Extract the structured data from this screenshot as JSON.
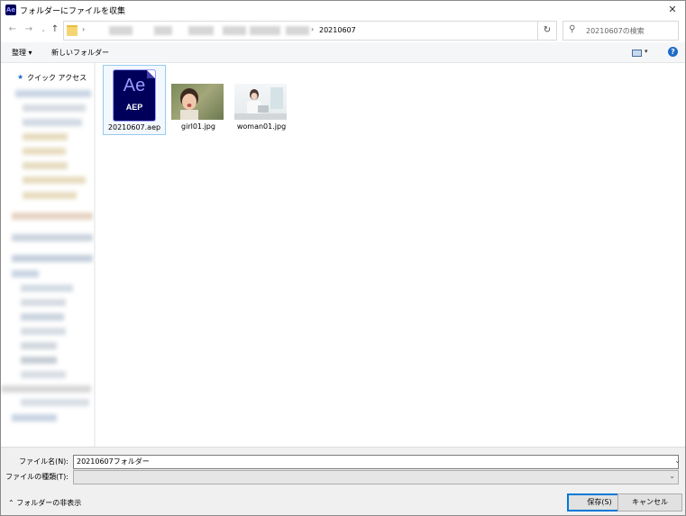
{
  "window": {
    "app_icon": "Ae",
    "title": "フォルダーにファイルを収集"
  },
  "address": {
    "current_folder": "20210607",
    "search_placeholder": "20210607の検索"
  },
  "toolbar": {
    "organize_label": "整理 ▾",
    "new_folder_label": "新しいフォルダー"
  },
  "nav": {
    "quick_access_label": "クイック アクセス"
  },
  "files": [
    {
      "name": "20210607.aep",
      "icon_big": "Ae",
      "icon_small": "AEP",
      "type": "ae-project"
    },
    {
      "name": "girl01.jpg",
      "type": "image"
    },
    {
      "name": "woman01.jpg",
      "type": "image"
    }
  ],
  "form": {
    "filename_label": "ファイル名(N):",
    "filename_value": "20210607フォルダー",
    "filetype_label": "ファイルの種類(T):",
    "filetype_value": ""
  },
  "footer": {
    "hide_folders_label": "⌃ フォルダーの非表示",
    "save_label": "保存(S)",
    "cancel_label": "キャンセル"
  },
  "colors": {
    "ae_dark": "#00005b",
    "ae_light": "#9999ff",
    "accent": "#0078d7"
  }
}
